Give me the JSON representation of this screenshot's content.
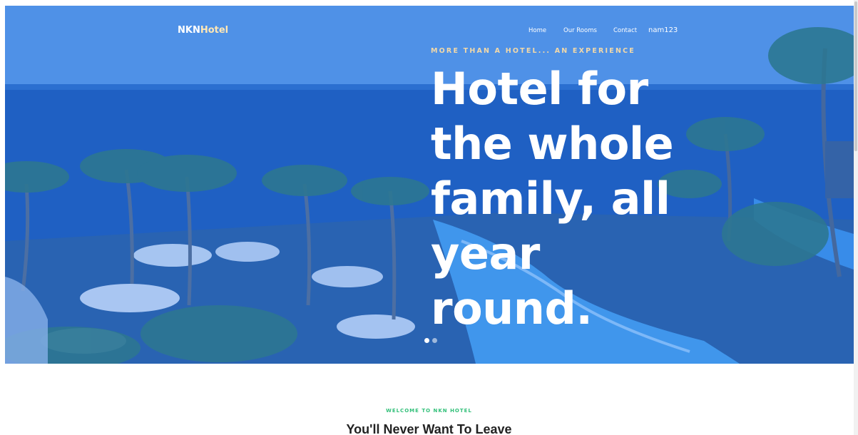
{
  "header": {
    "brand_a": "NKN",
    "brand_b": "Hotel",
    "nav": [
      {
        "label": "Home"
      },
      {
        "label": "Our Rooms"
      },
      {
        "label": "Contact"
      }
    ],
    "user": "nam123"
  },
  "hero": {
    "eyebrow": "MORE THAN A HOTEL... AN EXPERIENCE",
    "headline_lines": [
      "Hotel for",
      "the whole",
      "family, all",
      "year",
      "round."
    ],
    "slides_total": 2,
    "slide_active": 1
  },
  "section": {
    "eyebrow": "WELCOME TO NKN HOTEL",
    "title": "You'll Never Want To Leave"
  },
  "colors": {
    "overlay": "#2f6fd6",
    "eyebrow": "#f3d9a8",
    "welcome": "#33c07a",
    "text": "#ffffff"
  }
}
